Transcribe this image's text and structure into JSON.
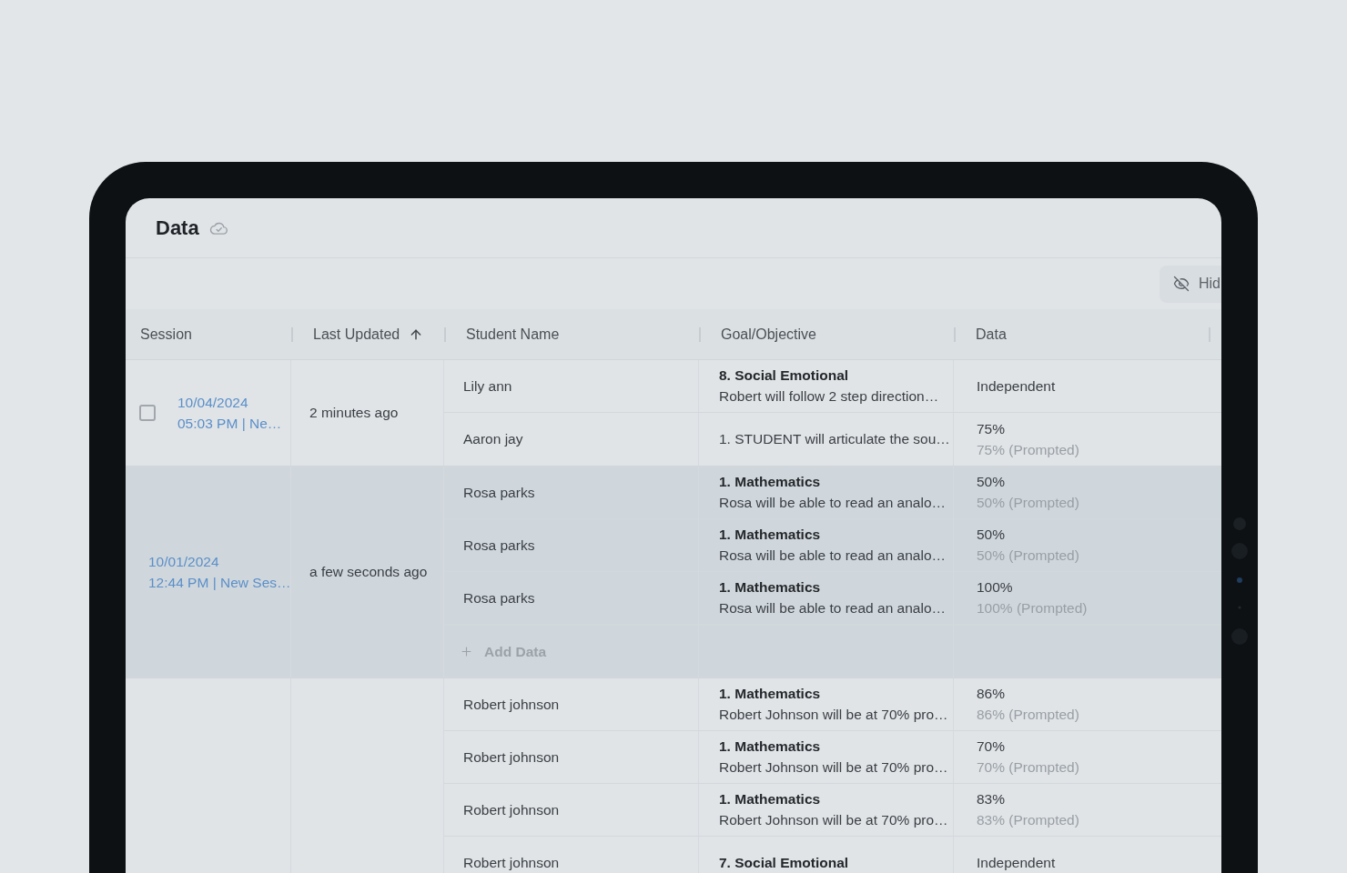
{
  "page": {
    "title": "Data"
  },
  "toolbar": {
    "hide_button": {
      "label": "Hid"
    }
  },
  "table": {
    "columns": [
      {
        "label": "Session",
        "sorted": false
      },
      {
        "label": "Last Updated",
        "sorted": true
      },
      {
        "label": "Student Name",
        "sorted": false
      },
      {
        "label": "Goal/Objective",
        "sorted": false
      },
      {
        "label": "Data",
        "sorted": false
      }
    ],
    "groups": [
      {
        "highlighted": false,
        "checkbox": {
          "checked": false
        },
        "session": {
          "date": "10/04/2024",
          "detail": "05:03 PM | Ne…"
        },
        "last_updated": "2 minutes ago",
        "rows": [
          {
            "student": "Lily ann",
            "goal": {
              "title": "8. Social Emotional",
              "description": "Robert will follow 2 step direction…"
            },
            "data": {
              "value": "Independent"
            }
          },
          {
            "student": "Aaron jay",
            "goal": {
              "description": "1. STUDENT will articulate the sou…"
            },
            "data": {
              "value": "75%",
              "detail": "75% (Prompted)"
            }
          }
        ]
      },
      {
        "highlighted": true,
        "session": {
          "date": "10/01/2024",
          "detail": "12:44 PM | New Ses…"
        },
        "last_updated": "a few seconds ago",
        "rows": [
          {
            "student": "Rosa parks",
            "goal": {
              "title": "1. Mathematics",
              "description": "Rosa will be able to read an analo…"
            },
            "data": {
              "value": "50%",
              "detail": "50% (Prompted)"
            }
          },
          {
            "student": "Rosa parks",
            "goal": {
              "title": "1. Mathematics",
              "description": "Rosa will be able to read an analo…"
            },
            "data": {
              "value": "50%",
              "detail": "50% (Prompted)"
            }
          },
          {
            "student": "Rosa parks",
            "goal": {
              "title": "1. Mathematics",
              "description": "Rosa will be able to read an analo…"
            },
            "data": {
              "value": "100%",
              "detail": "100% (Prompted)"
            }
          }
        ],
        "add_data": {
          "label": "Add Data"
        }
      },
      {
        "highlighted": false,
        "rows": [
          {
            "student": "Robert johnson",
            "goal": {
              "title": "1. Mathematics",
              "description": "Robert Johnson will be at 70% pro…"
            },
            "data": {
              "value": "86%",
              "detail": "86% (Prompted)"
            }
          },
          {
            "student": "Robert johnson",
            "goal": {
              "title": "1. Mathematics",
              "description": "Robert Johnson will be at 70% pro…"
            },
            "data": {
              "value": "70%",
              "detail": "70% (Prompted)"
            }
          },
          {
            "student": "Robert johnson",
            "goal": {
              "title": "1. Mathematics",
              "description": "Robert Johnson will be at 70% pro…"
            },
            "data": {
              "value": "83%",
              "detail": "83% (Prompted)"
            }
          },
          {
            "student": "Robert johnson",
            "goal": {
              "title": "7. Social Emotional"
            },
            "data": {
              "value": "Independent"
            }
          }
        ]
      }
    ]
  }
}
